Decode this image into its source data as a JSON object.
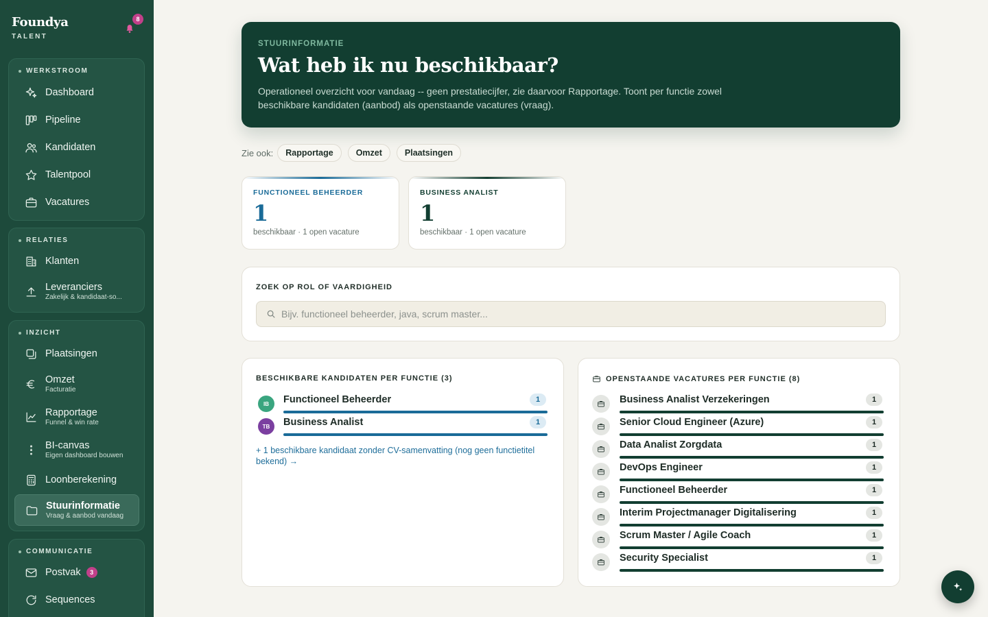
{
  "brand": {
    "name": "Foundya",
    "sub": "TALENT",
    "notifications": "8"
  },
  "nav": {
    "werkstroom": {
      "title": "WERKSTROOM",
      "items": [
        {
          "label": "Dashboard",
          "icon": "sparkles-icon"
        },
        {
          "label": "Pipeline",
          "icon": "kanban-icon"
        },
        {
          "label": "Kandidaten",
          "icon": "users-icon"
        },
        {
          "label": "Talentpool",
          "icon": "star-icon"
        },
        {
          "label": "Vacatures",
          "icon": "briefcase-icon"
        }
      ]
    },
    "relaties": {
      "title": "RELATIES",
      "items": [
        {
          "label": "Klanten",
          "icon": "building-icon"
        },
        {
          "label": "Leveranciers",
          "sub": "Zakelijk & kandidaat-so...",
          "icon": "upload-icon"
        }
      ]
    },
    "inzicht": {
      "title": "INZICHT",
      "items": [
        {
          "label": "Plaatsingen",
          "icon": "copy-icon"
        },
        {
          "label": "Omzet",
          "sub": "Facturatie",
          "icon": "euro-icon"
        },
        {
          "label": "Rapportage",
          "sub": "Funnel & win rate",
          "icon": "chart-icon"
        },
        {
          "label": "BI-canvas",
          "sub": "Eigen dashboard bouwen",
          "icon": "grip-icon"
        },
        {
          "label": "Loonberekening",
          "icon": "calculator-icon"
        },
        {
          "label": "Stuurinformatie",
          "sub": "Vraag & aanbod vandaag",
          "icon": "folder-icon"
        }
      ]
    },
    "communicatie": {
      "title": "COMMUNICATIE",
      "items": [
        {
          "label": "Postvak",
          "badge": "3",
          "icon": "mail-icon"
        },
        {
          "label": "Sequences",
          "icon": "refresh-icon"
        }
      ]
    }
  },
  "hero": {
    "eyebrow": "STUURINFORMATIE",
    "title": "Wat heb ik nu beschikbaar?",
    "description": "Operationeel overzicht voor vandaag -- geen prestatiecijfer, zie daarvoor Rapportage. Toont per functie zowel beschikbare kandidaten (aanbod) als openstaande vacatures (vraag)."
  },
  "see_also": {
    "label": "Zie ook:",
    "links": [
      "Rapportage",
      "Omzet",
      "Plaatsingen"
    ]
  },
  "stat_cards": [
    {
      "title": "FUNCTIONEEL BEHEERDER",
      "value": "1",
      "sub": "beschikbaar · 1 open vacature",
      "color": "#1a6b98"
    },
    {
      "title": "BUSINESS ANALIST",
      "value": "1",
      "sub": "beschikbaar · 1 open vacature",
      "color": "#123e31"
    }
  ],
  "search": {
    "title": "ZOEK OP ROL OF VAARDIGHEID",
    "placeholder": "Bijv. functioneel beheerder, java, scrum master..."
  },
  "candidates": {
    "title": "BESCHIKBARE KANDIDATEN PER FUNCTIE (3)",
    "rows": [
      {
        "initials": "IB",
        "label": "Functioneel Beheerder",
        "count": "1",
        "avatar_color": "#3aa57f"
      },
      {
        "initials": "TB",
        "label": "Business Analist",
        "count": "1",
        "avatar_color": "#7b3fa0"
      }
    ],
    "more_link": "+ 1 beschikbare kandidaat zonder CV-samenvatting (nog geen functietitel bekend) →"
  },
  "vacancies": {
    "title": "OPENSTAANDE VACATURES PER FUNCTIE (8)",
    "rows": [
      {
        "label": "Business Analist Verzekeringen",
        "count": "1"
      },
      {
        "label": "Senior Cloud Engineer (Azure)",
        "count": "1"
      },
      {
        "label": "Data Analist Zorgdata",
        "count": "1"
      },
      {
        "label": "DevOps Engineer",
        "count": "1"
      },
      {
        "label": "Functioneel Beheerder",
        "count": "1"
      },
      {
        "label": "Interim Projectmanager Digitalisering",
        "count": "1"
      },
      {
        "label": "Scrum Master / Agile Coach",
        "count": "1"
      },
      {
        "label": "Security Specialist",
        "count": "1"
      }
    ]
  },
  "colors": {
    "sidebar": "#1d4a3b",
    "hero": "#123e31",
    "accent_blue": "#1a6b98",
    "badge_pink": "#c2408a"
  }
}
